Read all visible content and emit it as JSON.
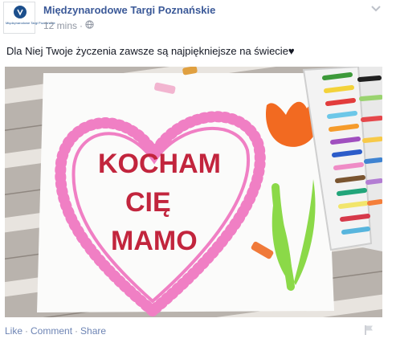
{
  "post": {
    "page_name": "Międzynarodowe Targi Poznańskie",
    "avatar_logo_text": "Międzynarodowe Targi Poznańskie",
    "timestamp": "12 mins",
    "separator": "·",
    "message": "Dla Niej Twoje życzenia zawsze są najpiękniejsze na świecie♥",
    "photo": {
      "line1": "KOCHAM",
      "line2": "CIĘ",
      "line3": "MAMO"
    }
  },
  "actions": {
    "like": "Like",
    "comment": "Comment",
    "share": "Share",
    "dot": "·"
  },
  "colors": {
    "link": "#3b5998",
    "action_link": "#6d84b4",
    "meta": "#9197a3",
    "heart_pink": "#f07fc4",
    "letters_red": "#c2253d"
  },
  "icons": [
    "chevron-down-icon",
    "globe-icon",
    "flag-icon"
  ]
}
